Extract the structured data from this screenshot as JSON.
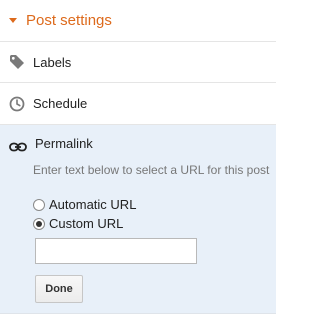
{
  "header": {
    "title": "Post settings",
    "icon": "caret-down-icon",
    "accent_color": "#dd6a1c"
  },
  "rows": {
    "labels": {
      "label": "Labels",
      "icon": "tag-icon"
    },
    "schedule": {
      "label": "Schedule",
      "icon": "clock-icon"
    }
  },
  "permalink": {
    "label": "Permalink",
    "icon": "link-icon",
    "hint": "Enter text below to select a URL for this post",
    "options": [
      {
        "label": "Automatic URL",
        "checked": false
      },
      {
        "label": "Custom URL",
        "checked": true
      }
    ],
    "custom_url_value": "",
    "done_label": "Done",
    "background": "#e8f0f9"
  }
}
